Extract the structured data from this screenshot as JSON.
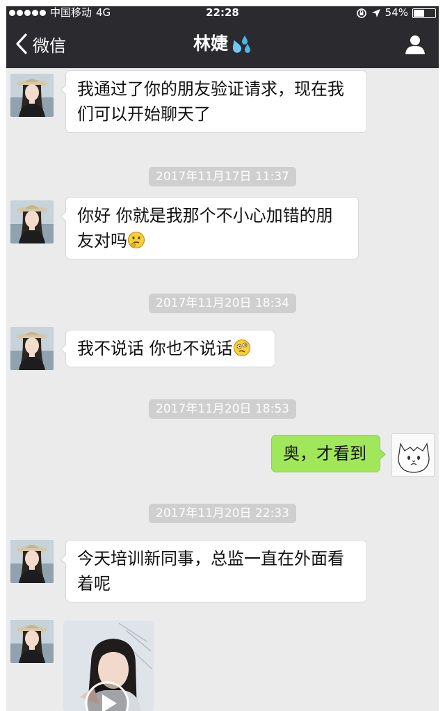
{
  "status_bar": {
    "carrier": "中国移动",
    "network": "4G",
    "time": "22:28",
    "battery": "54%",
    "battery_level": 0.54
  },
  "nav": {
    "back_label": "微信",
    "title": "林婕",
    "title_icon": "sweat-droplets-icon",
    "profile_icon": "person-icon"
  },
  "messages": [
    {
      "side": "left",
      "text": "我通过了你的朋友验证请求，现在我们可以开始聊天了"
    },
    {
      "side": "left",
      "text": "你好  你就是我那个不小心加错的朋友对吗",
      "emoji": "thinking-face-icon"
    },
    {
      "side": "left",
      "text": "我不说话  你也不说话",
      "emoji": "confused-face-icon"
    },
    {
      "side": "right",
      "text": "奥，才看到"
    },
    {
      "side": "left",
      "text": "今天培训新同事，总监一直在外面看着呢"
    },
    {
      "side": "left",
      "type": "video",
      "icon": "play-icon"
    }
  ],
  "timestamps": [
    "2017年11月17日 11:37",
    "2017年11月20日 18:34",
    "2017年11月20日 18:53",
    "2017年11月20日 22:33"
  ],
  "colors": {
    "bar": "#2b2b2f",
    "chat_bg": "#ebebeb",
    "bubble_self": "#a0e75a",
    "bubble_other": "#ffffff",
    "timestamp_bg": "#cfcfcf"
  }
}
